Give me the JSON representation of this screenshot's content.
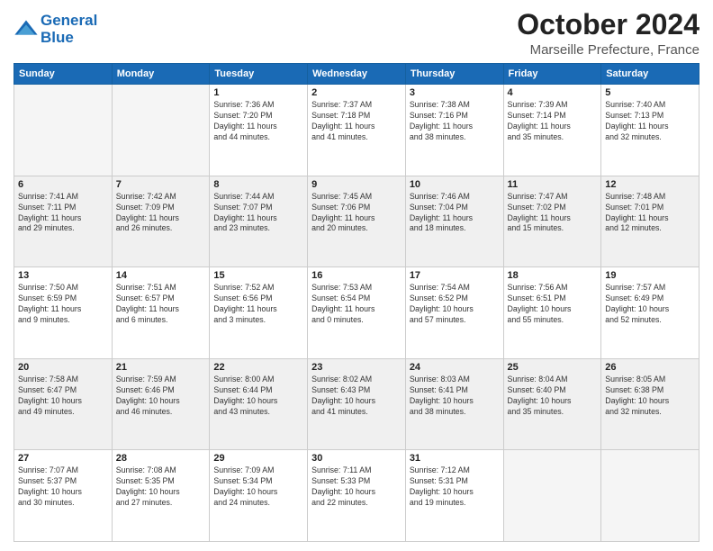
{
  "header": {
    "logo_line1": "General",
    "logo_line2": "Blue",
    "month_title": "October 2024",
    "subtitle": "Marseille Prefecture, France"
  },
  "weekdays": [
    "Sunday",
    "Monday",
    "Tuesday",
    "Wednesday",
    "Thursday",
    "Friday",
    "Saturday"
  ],
  "weeks": [
    [
      {
        "day": "",
        "info": ""
      },
      {
        "day": "",
        "info": ""
      },
      {
        "day": "1",
        "info": "Sunrise: 7:36 AM\nSunset: 7:20 PM\nDaylight: 11 hours\nand 44 minutes."
      },
      {
        "day": "2",
        "info": "Sunrise: 7:37 AM\nSunset: 7:18 PM\nDaylight: 11 hours\nand 41 minutes."
      },
      {
        "day": "3",
        "info": "Sunrise: 7:38 AM\nSunset: 7:16 PM\nDaylight: 11 hours\nand 38 minutes."
      },
      {
        "day": "4",
        "info": "Sunrise: 7:39 AM\nSunset: 7:14 PM\nDaylight: 11 hours\nand 35 minutes."
      },
      {
        "day": "5",
        "info": "Sunrise: 7:40 AM\nSunset: 7:13 PM\nDaylight: 11 hours\nand 32 minutes."
      }
    ],
    [
      {
        "day": "6",
        "info": "Sunrise: 7:41 AM\nSunset: 7:11 PM\nDaylight: 11 hours\nand 29 minutes."
      },
      {
        "day": "7",
        "info": "Sunrise: 7:42 AM\nSunset: 7:09 PM\nDaylight: 11 hours\nand 26 minutes."
      },
      {
        "day": "8",
        "info": "Sunrise: 7:44 AM\nSunset: 7:07 PM\nDaylight: 11 hours\nand 23 minutes."
      },
      {
        "day": "9",
        "info": "Sunrise: 7:45 AM\nSunset: 7:06 PM\nDaylight: 11 hours\nand 20 minutes."
      },
      {
        "day": "10",
        "info": "Sunrise: 7:46 AM\nSunset: 7:04 PM\nDaylight: 11 hours\nand 18 minutes."
      },
      {
        "day": "11",
        "info": "Sunrise: 7:47 AM\nSunset: 7:02 PM\nDaylight: 11 hours\nand 15 minutes."
      },
      {
        "day": "12",
        "info": "Sunrise: 7:48 AM\nSunset: 7:01 PM\nDaylight: 11 hours\nand 12 minutes."
      }
    ],
    [
      {
        "day": "13",
        "info": "Sunrise: 7:50 AM\nSunset: 6:59 PM\nDaylight: 11 hours\nand 9 minutes."
      },
      {
        "day": "14",
        "info": "Sunrise: 7:51 AM\nSunset: 6:57 PM\nDaylight: 11 hours\nand 6 minutes."
      },
      {
        "day": "15",
        "info": "Sunrise: 7:52 AM\nSunset: 6:56 PM\nDaylight: 11 hours\nand 3 minutes."
      },
      {
        "day": "16",
        "info": "Sunrise: 7:53 AM\nSunset: 6:54 PM\nDaylight: 11 hours\nand 0 minutes."
      },
      {
        "day": "17",
        "info": "Sunrise: 7:54 AM\nSunset: 6:52 PM\nDaylight: 10 hours\nand 57 minutes."
      },
      {
        "day": "18",
        "info": "Sunrise: 7:56 AM\nSunset: 6:51 PM\nDaylight: 10 hours\nand 55 minutes."
      },
      {
        "day": "19",
        "info": "Sunrise: 7:57 AM\nSunset: 6:49 PM\nDaylight: 10 hours\nand 52 minutes."
      }
    ],
    [
      {
        "day": "20",
        "info": "Sunrise: 7:58 AM\nSunset: 6:47 PM\nDaylight: 10 hours\nand 49 minutes."
      },
      {
        "day": "21",
        "info": "Sunrise: 7:59 AM\nSunset: 6:46 PM\nDaylight: 10 hours\nand 46 minutes."
      },
      {
        "day": "22",
        "info": "Sunrise: 8:00 AM\nSunset: 6:44 PM\nDaylight: 10 hours\nand 43 minutes."
      },
      {
        "day": "23",
        "info": "Sunrise: 8:02 AM\nSunset: 6:43 PM\nDaylight: 10 hours\nand 41 minutes."
      },
      {
        "day": "24",
        "info": "Sunrise: 8:03 AM\nSunset: 6:41 PM\nDaylight: 10 hours\nand 38 minutes."
      },
      {
        "day": "25",
        "info": "Sunrise: 8:04 AM\nSunset: 6:40 PM\nDaylight: 10 hours\nand 35 minutes."
      },
      {
        "day": "26",
        "info": "Sunrise: 8:05 AM\nSunset: 6:38 PM\nDaylight: 10 hours\nand 32 minutes."
      }
    ],
    [
      {
        "day": "27",
        "info": "Sunrise: 7:07 AM\nSunset: 5:37 PM\nDaylight: 10 hours\nand 30 minutes."
      },
      {
        "day": "28",
        "info": "Sunrise: 7:08 AM\nSunset: 5:35 PM\nDaylight: 10 hours\nand 27 minutes."
      },
      {
        "day": "29",
        "info": "Sunrise: 7:09 AM\nSunset: 5:34 PM\nDaylight: 10 hours\nand 24 minutes."
      },
      {
        "day": "30",
        "info": "Sunrise: 7:11 AM\nSunset: 5:33 PM\nDaylight: 10 hours\nand 22 minutes."
      },
      {
        "day": "31",
        "info": "Sunrise: 7:12 AM\nSunset: 5:31 PM\nDaylight: 10 hours\nand 19 minutes."
      },
      {
        "day": "",
        "info": ""
      },
      {
        "day": "",
        "info": ""
      }
    ]
  ]
}
